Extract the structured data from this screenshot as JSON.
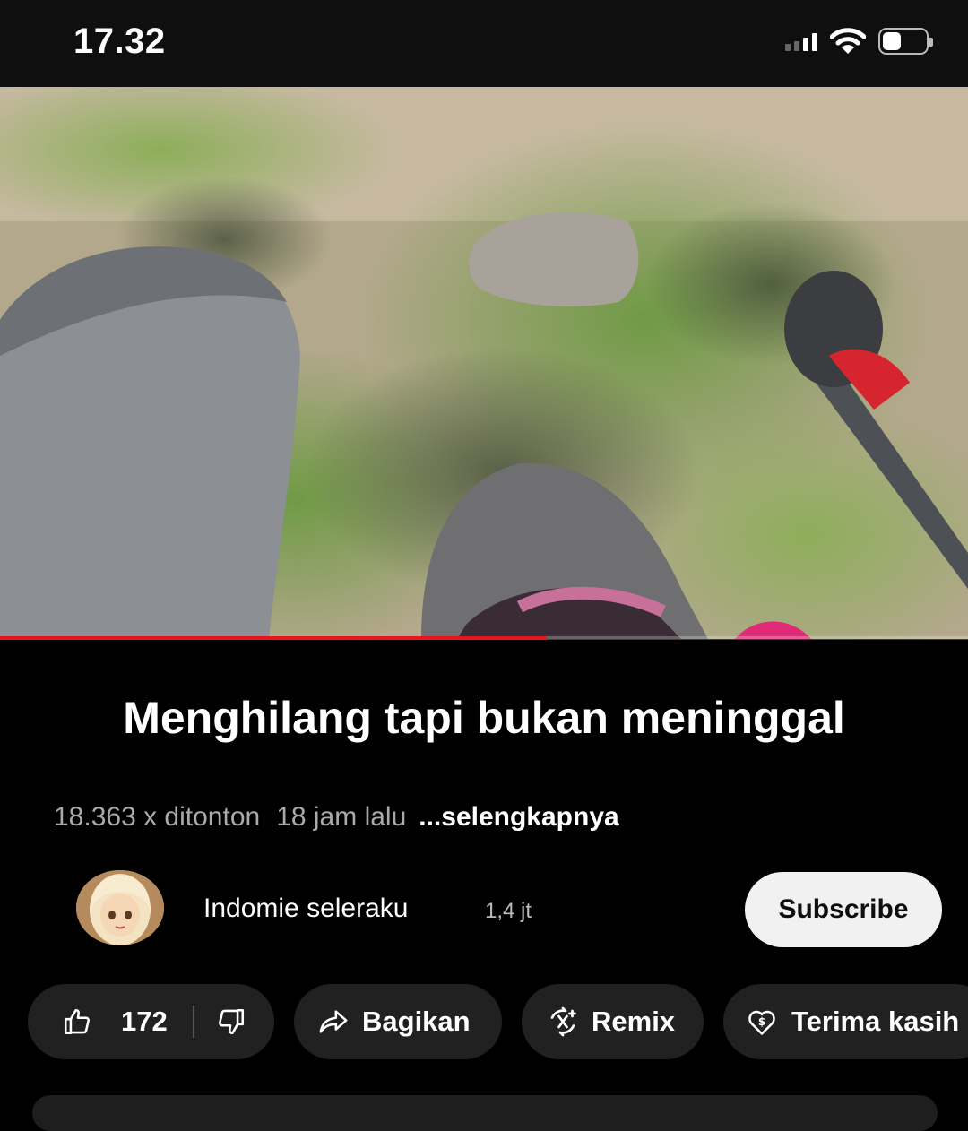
{
  "status_bar": {
    "time": "17.32",
    "battery_level": 0.45,
    "signal_bars": 4,
    "signal_active": 2
  },
  "video": {
    "progress": 0.565,
    "progress_color": "#e6161e"
  },
  "title": "Menghilang tapi bukan meninggal",
  "meta": {
    "views": "18.363 x ditonton",
    "age": "18 jam lalu",
    "more": "...selengkapnya"
  },
  "channel": {
    "name": "Indomie seleraku",
    "subscribers": "1,4 jt",
    "subscribe_label": "Subscribe"
  },
  "actions": {
    "like_count": "172",
    "share_label": "Bagikan",
    "remix_label": "Remix",
    "thanks_label": "Terima kasih"
  },
  "icons": [
    "signal-icon",
    "wifi-icon",
    "battery-icon",
    "thumbs-up-icon",
    "thumbs-down-icon",
    "share-icon",
    "remix-icon",
    "thanks-icon"
  ]
}
